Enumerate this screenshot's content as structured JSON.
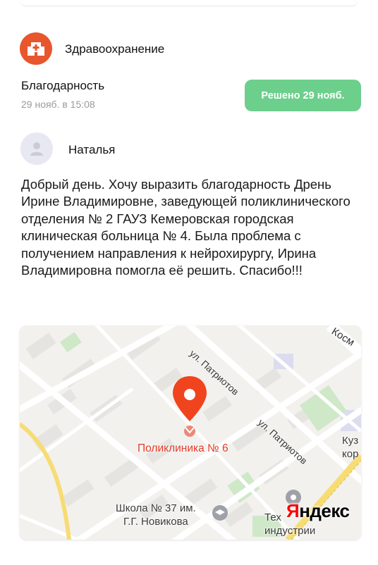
{
  "category": {
    "name": "Здравоохранение",
    "icon": "hospital-icon",
    "color": "#e8562d"
  },
  "issue": {
    "title": "Благодарность",
    "date": "29 нояб. в 15:08",
    "status": "Решено 29 нояб.",
    "status_color": "#6ccf8c"
  },
  "author": {
    "name": "Наталья",
    "icon": "user-icon"
  },
  "message": "Добрый день. Хочу выразить благодарность Дрень Ирине Владимировне, заведующей поликлинического отделения № 2 ГАУЗ Кемеровская городская клиническая больница № 4. Была проблема с получением направления к нейрохирургу, Ирина Владимировна помогла её решить. Спасибо!!!",
  "map": {
    "poi_label": "Поликлиника № 6",
    "streets": [
      "ул. Патриотов",
      "ул. Патриотов",
      "Косм"
    ],
    "places": [
      {
        "line1": "Школа № 37 им.",
        "line2": "Г.Г. Новикова"
      },
      {
        "line1": "Тех",
        "line2": "индустрии"
      },
      {
        "line1": "Куз",
        "line2": "кор"
      }
    ],
    "logo_prefix": "Я",
    "logo_rest": "ндекс",
    "pin_color": "#f0441e"
  }
}
